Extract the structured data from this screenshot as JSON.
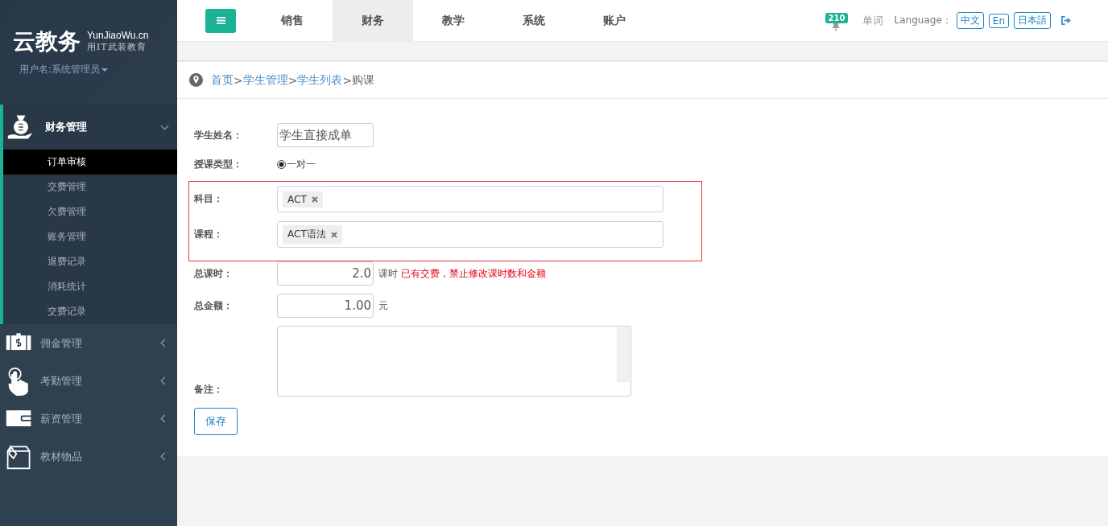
{
  "sidebar": {
    "logo": "云教务",
    "site": "YunJiaoWu.cn",
    "slogan": "用IT武装教育",
    "user": "用户名:系统管理员",
    "menus": [
      {
        "label": "财务管理",
        "expanded": true,
        "children": [
          {
            "label": "订单审核",
            "selected": true
          },
          {
            "label": "交费管理",
            "selected": false
          },
          {
            "label": "欠费管理",
            "selected": false
          },
          {
            "label": "账务管理",
            "selected": false
          },
          {
            "label": "退费记录",
            "selected": false
          },
          {
            "label": "消耗统计",
            "selected": false
          },
          {
            "label": "交费记录",
            "selected": false
          }
        ]
      },
      {
        "label": "佣金管理",
        "expanded": false
      },
      {
        "label": "考勤管理",
        "expanded": false
      },
      {
        "label": "薪资管理",
        "expanded": false
      },
      {
        "label": "教材物品",
        "expanded": false
      }
    ]
  },
  "topbar": {
    "tabs": [
      {
        "label": "销售",
        "selected": false
      },
      {
        "label": "财务",
        "selected": true
      },
      {
        "label": "教学",
        "selected": false
      },
      {
        "label": "系统",
        "selected": false
      },
      {
        "label": "账户",
        "selected": false
      }
    ],
    "badge": "210",
    "words": "单词",
    "language_label": "Language：",
    "languages": [
      "中文",
      "En",
      "日本語"
    ]
  },
  "breadcrumb": {
    "separator": ">",
    "items": [
      {
        "label": "首页",
        "kind": "link"
      },
      {
        "label": "学生管理",
        "kind": "link"
      },
      {
        "label": "学生列表",
        "kind": "link"
      },
      {
        "label": "购课",
        "kind": "current"
      }
    ]
  },
  "form": {
    "sections": [
      {
        "highlighted": false,
        "rows": [
          {
            "kind": "text",
            "label": "学生姓名：",
            "value": "学生直接成单"
          },
          {
            "kind": "radio",
            "label": "授课类型：",
            "options": [
              {
                "label": "一对一",
                "selected": true
              }
            ]
          }
        ]
      },
      {
        "highlighted": true,
        "rows": [
          {
            "kind": "tags",
            "label": "科目：",
            "tags": [
              "ACT"
            ]
          },
          {
            "kind": "tags",
            "label": "课程：",
            "tags": [
              "ACT语法"
            ]
          }
        ]
      },
      {
        "highlighted": false,
        "rows": [
          {
            "kind": "number",
            "label": "总课时：",
            "value": "2.0",
            "unit": "课时",
            "note": "已有交费，禁止修改课时数和金额"
          },
          {
            "kind": "number",
            "label": "总金额：",
            "value": "1.00",
            "unit": "元"
          },
          {
            "kind": "textarea",
            "label": "备注："
          }
        ]
      }
    ],
    "save": "保存"
  }
}
